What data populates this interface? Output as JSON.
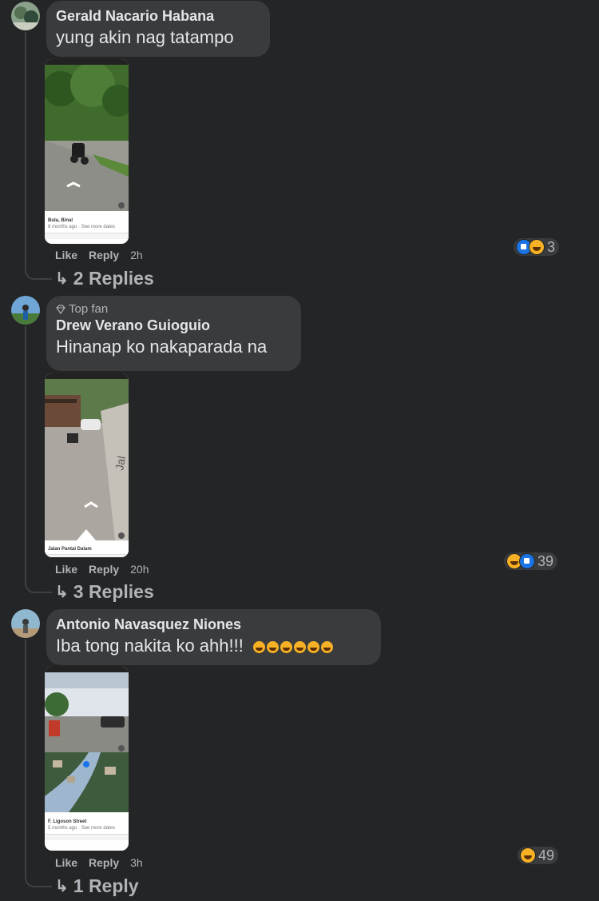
{
  "comments": [
    {
      "author": "Gerald Nacario Habana",
      "text": "yung akin nag tatampo",
      "photo_caption": "Bula, Binal",
      "photo_sub": "8 months ago · See more dates",
      "actions": {
        "like": "Like",
        "reply": "Reply",
        "time": "2h"
      },
      "reaction_count": "3",
      "replies": "2 Replies"
    },
    {
      "badge": "Top fan",
      "author": "Drew Verano Guioguio",
      "text": "Hinanap ko nakaparada na",
      "photo_caption": "Jalan Pantai Dalam",
      "actions": {
        "like": "Like",
        "reply": "Reply",
        "time": "20h"
      },
      "reaction_count": "39",
      "replies": "3 Replies"
    },
    {
      "author": "Antonio Navasquez Niones",
      "text": "Iba tong nakita ko ahh!!!",
      "photo_caption": "F. Ligoson Street",
      "photo_sub": "5 months ago · See more dates",
      "actions": {
        "like": "Like",
        "reply": "Reply",
        "time": "3h"
      },
      "reaction_count": "49",
      "replies": "1 Reply"
    }
  ],
  "colors": {
    "background": "#242526",
    "bubble": "#3a3b3c",
    "text": "#e4e6eb",
    "muted": "#b0b3b8",
    "like": "#1b74e4",
    "haha": "#f7b125"
  }
}
